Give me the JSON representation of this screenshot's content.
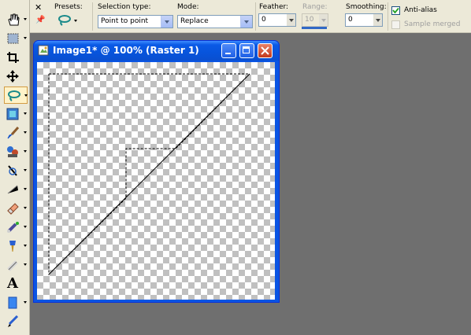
{
  "options": {
    "presets_label": "Presets:",
    "selection_type_label": "Selection type:",
    "selection_type_value": "Point to point",
    "mode_label": "Mode:",
    "mode_value": "Replace",
    "feather_label": "Feather:",
    "feather_value": "0",
    "range_label": "Range:",
    "range_value": "10",
    "smoothing_label": "Smoothing:",
    "smoothing_value": "0",
    "antialias_label": "Anti-alias",
    "antialias_checked": true,
    "sample_merged_label": "Sample merged",
    "sample_merged_checked": false
  },
  "toolbar": {
    "tools": [
      "pan-icon",
      "selection-icon",
      "crop-icon",
      "move-icon",
      "freehand-selection-icon",
      "magic-fill-icon",
      "paint-brush-icon",
      "clone-brush-icon",
      "scratch-remover-icon",
      "dodge-icon",
      "eraser-icon",
      "picture-tube-icon",
      "retouch-icon",
      "lighten-icon",
      "text-icon",
      "preset-shape-icon",
      "pen-icon"
    ],
    "text_tool_glyph": "A"
  },
  "image_window": {
    "title": "Image1* @ 100% (Raster 1)",
    "controls": [
      "minimize-icon",
      "maximize-icon",
      "close-icon"
    ]
  },
  "colors": {
    "workspace": "#6f6f6f",
    "titlebar": "#0a55e3",
    "close_button": "#c2391c",
    "checker": "#c0c0c0"
  }
}
